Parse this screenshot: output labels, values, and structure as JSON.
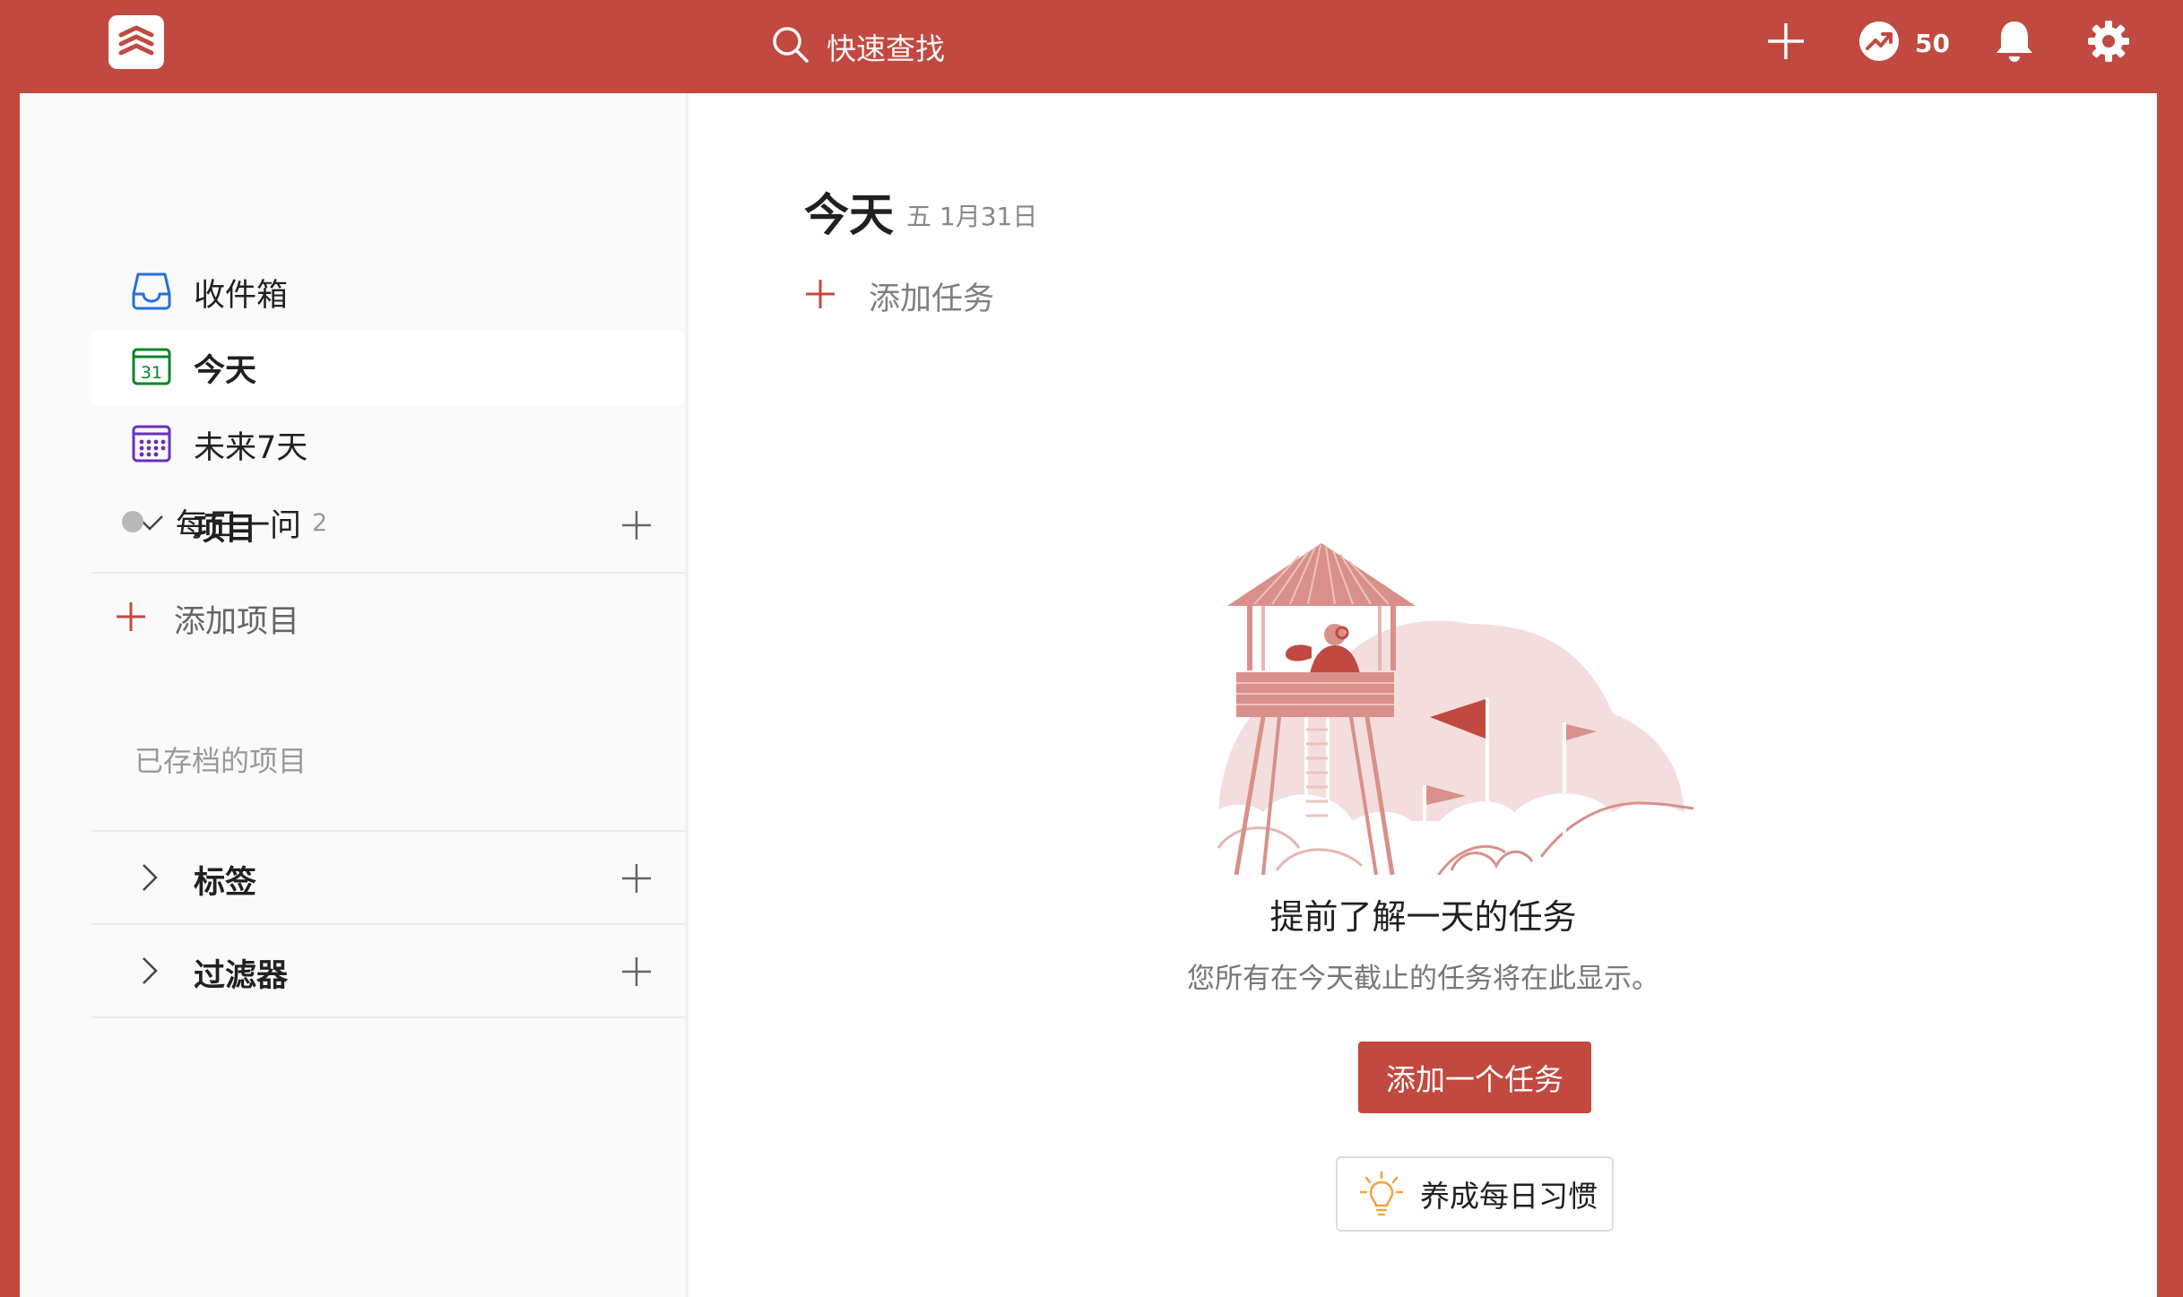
{
  "topbar": {
    "search_placeholder": "快速查找",
    "karma_score": "50"
  },
  "sidebar": {
    "items": [
      {
        "label": "收件箱",
        "icon": "inbox-icon"
      },
      {
        "label": "今天",
        "icon": "today-calendar-icon",
        "day_number": "31"
      },
      {
        "label": "未来7天",
        "icon": "upcoming-calendar-icon"
      }
    ],
    "projects_section": {
      "label": "项目"
    },
    "projects": [
      {
        "name": "每日一问",
        "count": "2"
      }
    ],
    "add_project_label": "添加项目",
    "archived_label": "已存档的项目",
    "labels_section": {
      "label": "标签"
    },
    "filters_section": {
      "label": "过滤器"
    }
  },
  "main": {
    "title": "今天",
    "date": "五 1月31日",
    "add_task_label": "添加任务",
    "empty_state": {
      "title": "提前了解一天的任务",
      "description": "您所有在今天截止的任务将在此显示。",
      "button_label": "添加一个任务",
      "habit_label": "养成每日习惯"
    }
  },
  "colors": {
    "brand": "#c1493f",
    "today_green": "#058527",
    "inbox_blue": "#246fe0",
    "upcoming_purple": "#692fc2",
    "illustration_light": "#f3dcdb",
    "illustration_mid": "#d9908a"
  }
}
